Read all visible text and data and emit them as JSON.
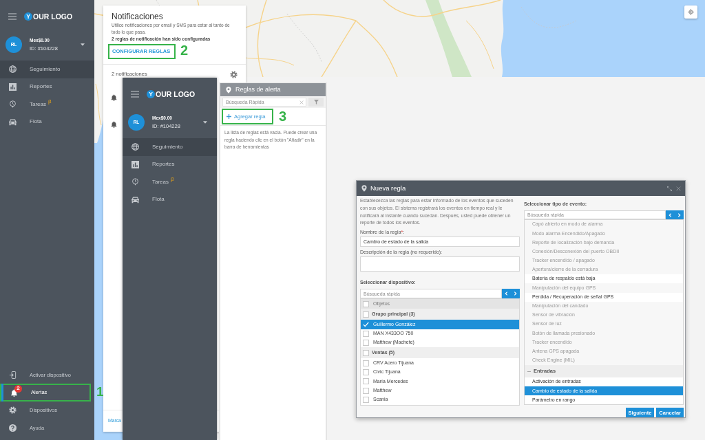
{
  "sidebar": {
    "logo": {
      "mark": "Y",
      "text": "OUR LOGO"
    },
    "account": {
      "initials": "RL",
      "balance": "Mex$0.00",
      "id": "ID: #104228"
    },
    "nav": [
      {
        "label": "Seguimiento",
        "highlighted": true
      },
      {
        "label": "Reportes",
        "highlighted": false
      },
      {
        "label": "Tareas",
        "highlighted": false,
        "superscript": "β"
      },
      {
        "label": "Flota",
        "highlighted": false
      }
    ],
    "bottom_nav": [
      {
        "label": "Activar dispositivo",
        "selected": false
      },
      {
        "label": "Alertas",
        "selected": true,
        "badge": "2",
        "annotation": "1"
      },
      {
        "label": "Dispositivos",
        "selected": false
      },
      {
        "label": "Ayuda",
        "selected": false
      }
    ]
  },
  "notifications": {
    "title": "Notificaciones",
    "description": "Utilice notificaciones por email y SMS para estar al tanto de todo lo que pasa.",
    "summary": "2 reglas de notificación han sido configuradas",
    "configure_button": {
      "label": "CONFIGURAR REGLAS",
      "annotation": "2"
    },
    "count": "2 notificaciones",
    "items": [
      {
        "kind": "alert"
      },
      {
        "kind": "alert"
      }
    ],
    "footer_link": "Marca"
  },
  "overlay_sidebar": {
    "logo": {
      "mark": "Y",
      "text": "OUR LOGO"
    },
    "account": {
      "initials": "RL",
      "balance": "Mex$0.00",
      "id": "ID: #104228"
    },
    "nav": [
      {
        "label": "Seguimiento",
        "highlighted": true
      },
      {
        "label": "Reportes",
        "highlighted": false
      },
      {
        "label": "Tareas",
        "highlighted": false,
        "superscript": "β"
      },
      {
        "label": "Flota",
        "highlighted": false
      }
    ]
  },
  "alert_rules": {
    "title": "Reglas de alerta",
    "search": {
      "placeholder": "Búsqueda Rápida"
    },
    "add_button": {
      "label": "Agregar regla",
      "annotation": "3"
    },
    "empty_message": "La lista de reglas está vacía. Puede crear una regla haciendo clic en el botón \"Añadir\" en la barra de herramientas"
  },
  "new_rule_dialog": {
    "title": "Nueva regla",
    "intro": "Establecezca las reglas para estar informado de los eventos que suceden con sus objetos. El sistema registrará los eventos en tiempo real y le notificará al instante cuando sucedan. Después, usted puede obtener un reporte de todos los eventos.",
    "name_field": {
      "label": "Nombre de la regla",
      "required_mark": "*",
      "label_end": ":",
      "value": "Cambio de estado de la salida"
    },
    "description_field": {
      "label": "Descripción de la regla (no requerido):"
    },
    "device_picker": {
      "title": "Seleccionar dispositivo:",
      "search": {
        "placeholder": "Búsqueda rápida"
      },
      "header": {
        "label": "Objetos",
        "checked": false
      },
      "groups": [
        {
          "label": "Grupo principal (3)",
          "checked": false,
          "items": [
            {
              "label": "Guillermo González",
              "checked": true,
              "selected": true
            },
            {
              "label": "MAN X433OO 750",
              "checked": false,
              "selected": false
            },
            {
              "label": "Matthew (Machete)",
              "checked": false,
              "selected": false
            }
          ]
        },
        {
          "label": "Ventas (5)",
          "checked": false,
          "items": [
            {
              "label": "CRV Acero Tijuana",
              "checked": false,
              "selected": false
            },
            {
              "label": "Civic Tijuana",
              "checked": false,
              "selected": false
            },
            {
              "label": "María Mercedes",
              "checked": false,
              "selected": false
            },
            {
              "label": "Matthew",
              "checked": false,
              "selected": false
            },
            {
              "label": "Scania",
              "checked": false,
              "selected": false
            }
          ]
        }
      ]
    },
    "event_picker": {
      "title": "Seleccionar tipo de evento:",
      "search": {
        "placeholder": "Búsqueda rápida"
      },
      "events": [
        {
          "label": "Capó abierto en modo de alarma",
          "disabled": true,
          "selected": false
        },
        {
          "label": "Modo alarma Encendido/Apagado",
          "disabled": true,
          "selected": false
        },
        {
          "label": "Reporte de localización bajo demanda",
          "disabled": true,
          "selected": false
        },
        {
          "label": "Conexión/Desconexión del puerto OBDII",
          "disabled": true,
          "selected": false
        },
        {
          "label": "Tracker encendido / apagado",
          "disabled": true,
          "selected": false
        },
        {
          "label": "Apertura/cierre de la cerradura",
          "disabled": true,
          "selected": false
        },
        {
          "label": "Batería de respaldo está baja",
          "disabled": false,
          "selected": false
        },
        {
          "label": "Manipulación del equipo GPS",
          "disabled": true,
          "selected": false
        },
        {
          "label": "Perdida / Recuperación de señal GPS",
          "disabled": false,
          "selected": false
        },
        {
          "label": "Manipulación del candado",
          "disabled": true,
          "selected": false
        },
        {
          "label": "Sensor de vibración",
          "disabled": true,
          "selected": false
        },
        {
          "label": "Sensor de luz",
          "disabled": true,
          "selected": false
        },
        {
          "label": "Botón de llamada presionado",
          "disabled": true,
          "selected": false
        },
        {
          "label": "Tracker encendido",
          "disabled": true,
          "selected": false
        },
        {
          "label": "Antena GPS apagada",
          "disabled": true,
          "selected": false
        },
        {
          "label": "Check Engine (MIL)",
          "disabled": true,
          "selected": false
        }
      ],
      "groups": [
        {
          "label": "Entradas",
          "expanded": true,
          "items": [
            {
              "label": "Activación de entradas",
              "disabled": false,
              "selected": false
            },
            {
              "label": "Cambio de estado de la salida",
              "disabled": false,
              "selected": true
            },
            {
              "label": "Parámetro en rango",
              "disabled": false,
              "selected": false
            }
          ]
        }
      ]
    },
    "buttons": [
      "Siguiente",
      "Cancelar"
    ]
  }
}
